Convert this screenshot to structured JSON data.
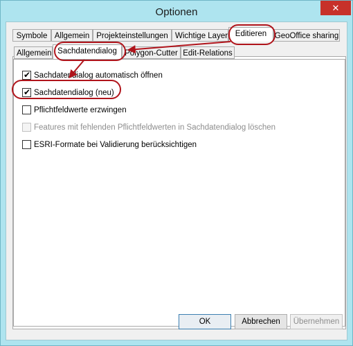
{
  "window": {
    "title": "Optionen",
    "close_glyph": "✕"
  },
  "tabs_main": [
    "Symbole",
    "Allgemein",
    "Projekteinstellungen",
    "Wichtige Layer",
    "Editieren",
    "GeoOffice sharing"
  ],
  "tabs_sub": [
    "Allgemein",
    "Sachdatendialog",
    "Polygon-Cutter",
    "Edit-Relations"
  ],
  "options": [
    {
      "label": "Sachdatendialog automatisch öffnen",
      "checked": true,
      "enabled": true
    },
    {
      "label": "Sachdatendialog (neu)",
      "checked": true,
      "enabled": true
    },
    {
      "label": "Pflichtfeldwerte erzwingen",
      "checked": false,
      "enabled": true
    },
    {
      "label": "Features mit fehlenden Pflichtfeldwerten in Sachdatendialog löschen",
      "checked": false,
      "enabled": false
    },
    {
      "label": "ESRI-Formate bei Validierung berücksichtigen",
      "checked": false,
      "enabled": true
    }
  ],
  "buttons": {
    "ok": "OK",
    "cancel": "Abbrechen",
    "apply": "Übernehmen"
  },
  "colors": {
    "frame": "#aee4ef",
    "close": "#c7312a",
    "annotation": "#b0141b"
  },
  "icons": {
    "check": "check-icon",
    "close": "close-icon"
  }
}
